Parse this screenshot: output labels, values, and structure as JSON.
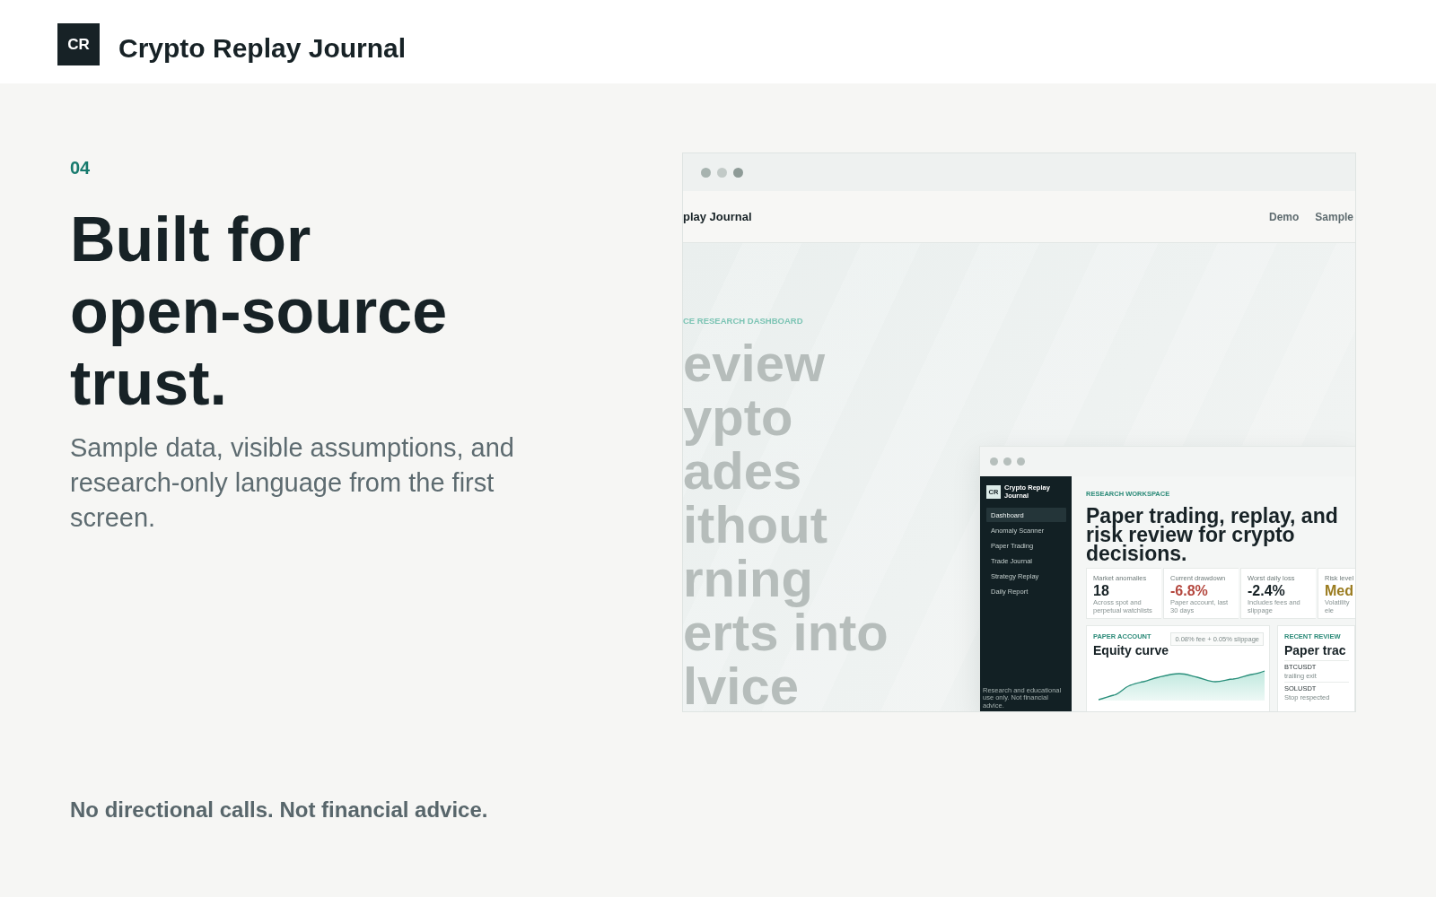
{
  "header": {
    "logo": "CR",
    "title": "Crypto Replay Journal"
  },
  "intro": {
    "number": "04",
    "heading": "Built for open-source trust.",
    "description": "Sample data, visible assumptions, and research-only language from the first screen."
  },
  "preview": {
    "site_header": {
      "brand": "play Journal",
      "nav": [
        "Demo",
        "Sample"
      ]
    },
    "hero": {
      "eyebrow": "CE RESEARCH DASHBOARD",
      "heading_lines": [
        "eview",
        "ypto",
        "ades",
        "ithout",
        "rning",
        "erts into",
        "lvice"
      ]
    },
    "app_window": {
      "sidebar": {
        "logo": "CR",
        "brand": "Crypto Replay Journal",
        "items": [
          {
            "label": "Dashboard",
            "selected": true
          },
          {
            "label": "Anomaly Scanner",
            "selected": false
          },
          {
            "label": "Paper Trading",
            "selected": false
          },
          {
            "label": "Trade Journal",
            "selected": false
          },
          {
            "label": "Strategy Replay",
            "selected": false
          },
          {
            "label": "Daily Report",
            "selected": false
          }
        ],
        "footnote": "Research and educational use only. Not financial advice."
      },
      "eyebrow": "RESEARCH WORKSPACE",
      "heading": "Paper trading, replay, and risk review for crypto decisions.",
      "stats": [
        {
          "label": "Market anomalies",
          "value": "18",
          "note": "Across spot and perpetual watchlists",
          "color": "#172226"
        },
        {
          "label": "Current drawdown",
          "value": "-6.8%",
          "note": "Paper account, last 30 days",
          "color": "#b4473e"
        },
        {
          "label": "Worst daily loss",
          "value": "-2.4%",
          "note": "Includes fees and slippage",
          "color": "#172226"
        },
        {
          "label": "Risk level",
          "value": "Med",
          "note": "Volatility ele",
          "color": "#9a7b1e"
        }
      ],
      "equity_card": {
        "eyebrow": "PAPER ACCOUNT",
        "title": "Equity curve",
        "tag": "0.08% fee + 0.05% slippage"
      },
      "review_card": {
        "eyebrow": "RECENT REVIEW",
        "title": "Paper trac",
        "rows": [
          {
            "symbol": "BTCUSDT",
            "note": "trailing exit"
          },
          {
            "symbol": "SOLUSDT",
            "note": "Stop respected"
          }
        ]
      }
    }
  },
  "disclaimer": "No directional calls. Not financial advice."
}
